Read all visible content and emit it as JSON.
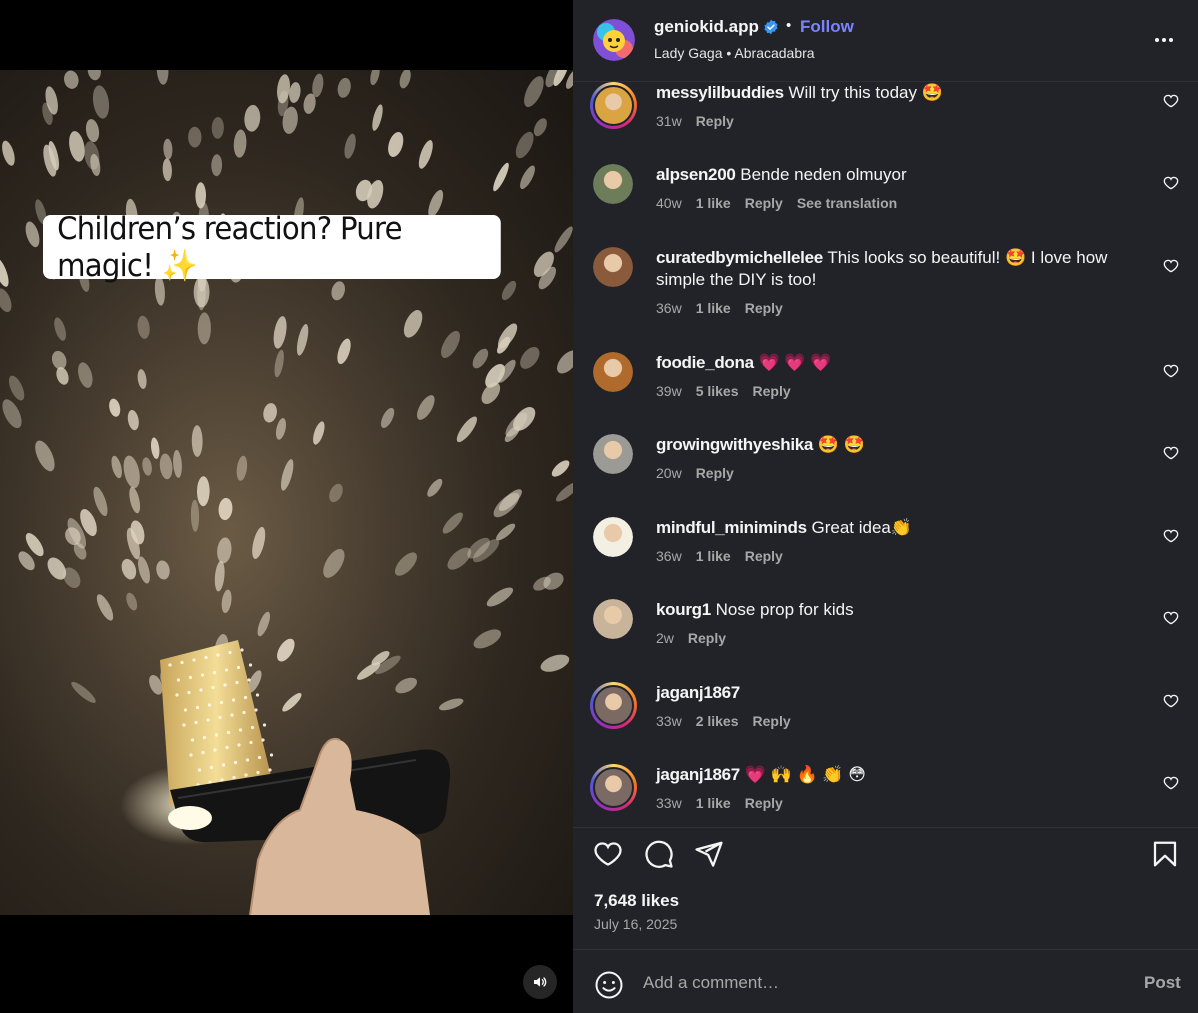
{
  "media": {
    "caption": "Children’s reaction? Pure magic! ✨",
    "sound_icon": "speaker-icon"
  },
  "header": {
    "username": "geniokid.app",
    "verified_icon": "verified-badge-icon",
    "separator": "•",
    "follow_label": "Follow",
    "audio": "Lady Gaga • Abracadabra",
    "more_icon": "more-options-icon"
  },
  "comments": [
    {
      "user": "messylilbuddies",
      "text": "Will try this today 🤩",
      "time": "31w",
      "likes": "",
      "reply": "Reply",
      "translate": "",
      "ring": true,
      "avatar_color": "#d9a441"
    },
    {
      "user": "alpsen200",
      "text": "Bende neden olmuyor",
      "time": "40w",
      "likes": "1 like",
      "reply": "Reply",
      "translate": "See translation",
      "ring": false,
      "avatar_color": "#6d7d5a"
    },
    {
      "user": "curatedbymichellelee",
      "text": "This looks so beautiful! 🤩 I love how simple the DIY is too!",
      "time": "36w",
      "likes": "1 like",
      "reply": "Reply",
      "translate": "",
      "ring": false,
      "avatar_color": "#8a5a3c"
    },
    {
      "user": "foodie_dona",
      "text": "💗 💗 💗",
      "time": "39w",
      "likes": "5 likes",
      "reply": "Reply",
      "translate": "",
      "ring": false,
      "avatar_color": "#b06a2c"
    },
    {
      "user": "growingwithyeshika",
      "text": "🤩 🤩",
      "time": "20w",
      "likes": "",
      "reply": "Reply",
      "translate": "",
      "ring": false,
      "avatar_color": "#9c9a95"
    },
    {
      "user": "mindful_miniminds",
      "text": "Great idea👏",
      "time": "36w",
      "likes": "1 like",
      "reply": "Reply",
      "translate": "",
      "ring": false,
      "avatar_color": "#f4efe3"
    },
    {
      "user": "kourg1",
      "text": "Nose prop for kids",
      "time": "2w",
      "likes": "",
      "reply": "Reply",
      "translate": "",
      "ring": false,
      "avatar_color": "#c8b49a"
    },
    {
      "user": "jaganj1867",
      "text": "",
      "time": "33w",
      "likes": "2 likes",
      "reply": "Reply",
      "translate": "",
      "ring": true,
      "avatar_color": "#7a6a63"
    },
    {
      "user": "jaganj1867",
      "text": "💗 🙌 🔥 👏 😳",
      "time": "33w",
      "likes": "1 like",
      "reply": "Reply",
      "translate": "",
      "ring": true,
      "avatar_color": "#7a6a63"
    }
  ],
  "actions": {
    "like_icon": "heart-icon",
    "comment_icon": "comment-bubble-icon",
    "share_icon": "paper-plane-icon",
    "save_icon": "bookmark-icon",
    "likes": "7,648 likes",
    "date": "July 16, 2025"
  },
  "composer": {
    "emoji_icon": "emoji-smile-icon",
    "placeholder": "Add a comment…",
    "post_label": "Post"
  }
}
